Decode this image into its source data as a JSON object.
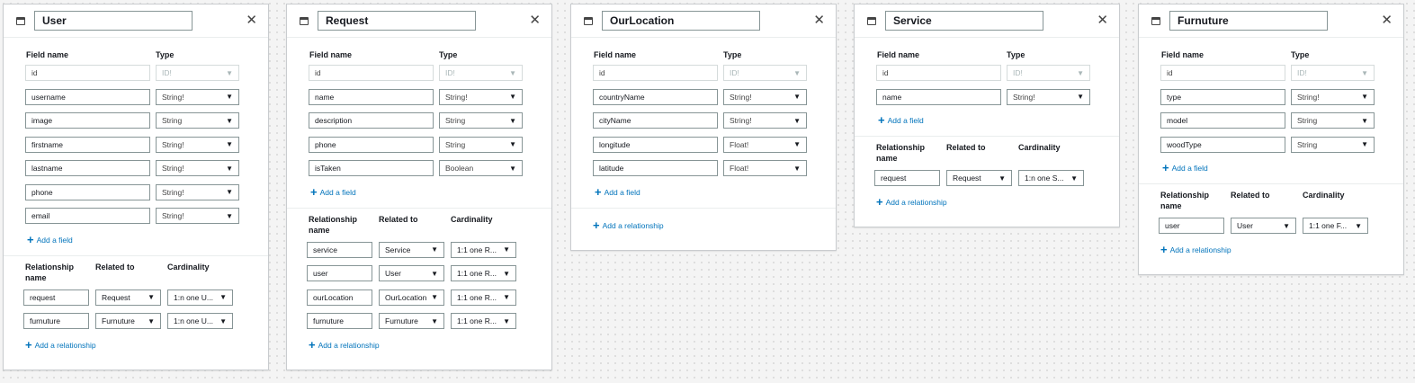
{
  "labels": {
    "field_name": "Field name",
    "type": "Type",
    "add_field": "Add a field",
    "relationship_name": "Relationship name",
    "related_to": "Related to",
    "cardinality": "Cardinality",
    "add_relationship": "Add a relationship",
    "close": "✕"
  },
  "models": [
    {
      "name": "User",
      "fields": [
        {
          "name": "id",
          "type": "ID!"
        },
        {
          "name": "username",
          "type": "String!"
        },
        {
          "name": "image",
          "type": "String"
        },
        {
          "name": "firstname",
          "type": "String!"
        },
        {
          "name": "lastname",
          "type": "String!"
        },
        {
          "name": "phone",
          "type": "String!"
        },
        {
          "name": "email",
          "type": "String!"
        }
      ],
      "relationships": [
        {
          "name": "request",
          "related": "Request",
          "cardinality": "1:n one U..."
        },
        {
          "name": "furnuture",
          "related": "Furnuture",
          "cardinality": "1:n one U..."
        }
      ]
    },
    {
      "name": "Request",
      "fields": [
        {
          "name": "id",
          "type": "ID!"
        },
        {
          "name": "name",
          "type": "String!"
        },
        {
          "name": "description",
          "type": "String"
        },
        {
          "name": "phone",
          "type": "String"
        },
        {
          "name": "isTaken",
          "type": "Boolean"
        }
      ],
      "relationships": [
        {
          "name": "service",
          "related": "Service",
          "cardinality": "1:1 one R..."
        },
        {
          "name": "user",
          "related": "User",
          "cardinality": "1:1 one R..."
        },
        {
          "name": "ourLocation",
          "related": "OurLocation",
          "cardinality": "1:1 one R..."
        },
        {
          "name": "furnuture",
          "related": "Furnuture",
          "cardinality": "1:1 one R..."
        }
      ]
    },
    {
      "name": "OurLocation",
      "fields": [
        {
          "name": "id",
          "type": "ID!"
        },
        {
          "name": "countryName",
          "type": "String!"
        },
        {
          "name": "cityName",
          "type": "String!"
        },
        {
          "name": "longitude",
          "type": "Float!"
        },
        {
          "name": "latitude",
          "type": "Float!"
        }
      ],
      "relationships": []
    },
    {
      "name": "Service",
      "fields": [
        {
          "name": "id",
          "type": "ID!"
        },
        {
          "name": "name",
          "type": "String!"
        }
      ],
      "relationships": [
        {
          "name": "request",
          "related": "Request",
          "cardinality": "1:n one S..."
        }
      ]
    },
    {
      "name": "Furnuture",
      "fields": [
        {
          "name": "id",
          "type": "ID!"
        },
        {
          "name": "type",
          "type": "String!"
        },
        {
          "name": "model",
          "type": "String"
        },
        {
          "name": "woodType",
          "type": "String"
        }
      ],
      "relationships": [
        {
          "name": "user",
          "related": "User",
          "cardinality": "1:1 one F..."
        }
      ]
    }
  ]
}
